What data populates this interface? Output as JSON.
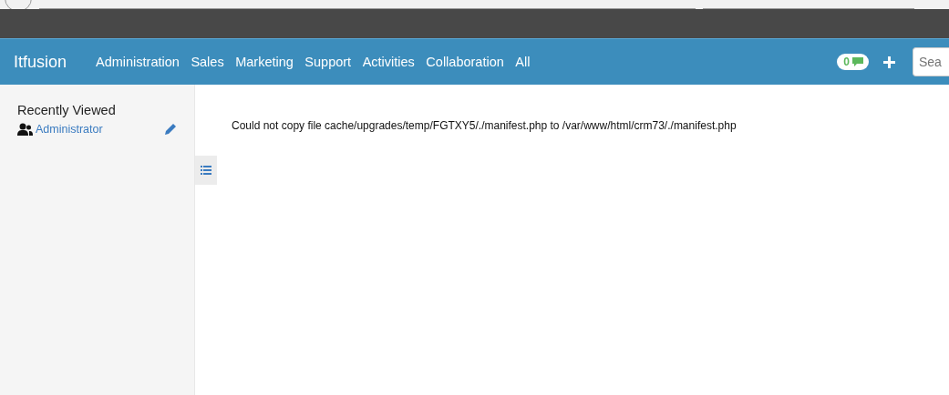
{
  "navbar": {
    "brand": "Itfusion",
    "menu": [
      "Administration",
      "Sales",
      "Marketing",
      "Support",
      "Activities",
      "Collaboration",
      "All"
    ],
    "notification_count": "0",
    "search": {
      "placeholder": "Sea"
    }
  },
  "sidebar": {
    "title": "Recently Viewed",
    "items": [
      {
        "label": "Administrator"
      }
    ]
  },
  "content": {
    "message": "Could not copy file cache/upgrades/temp/FGTXY5/./manifest.php to /var/www/html/crm73/./manifest.php"
  }
}
